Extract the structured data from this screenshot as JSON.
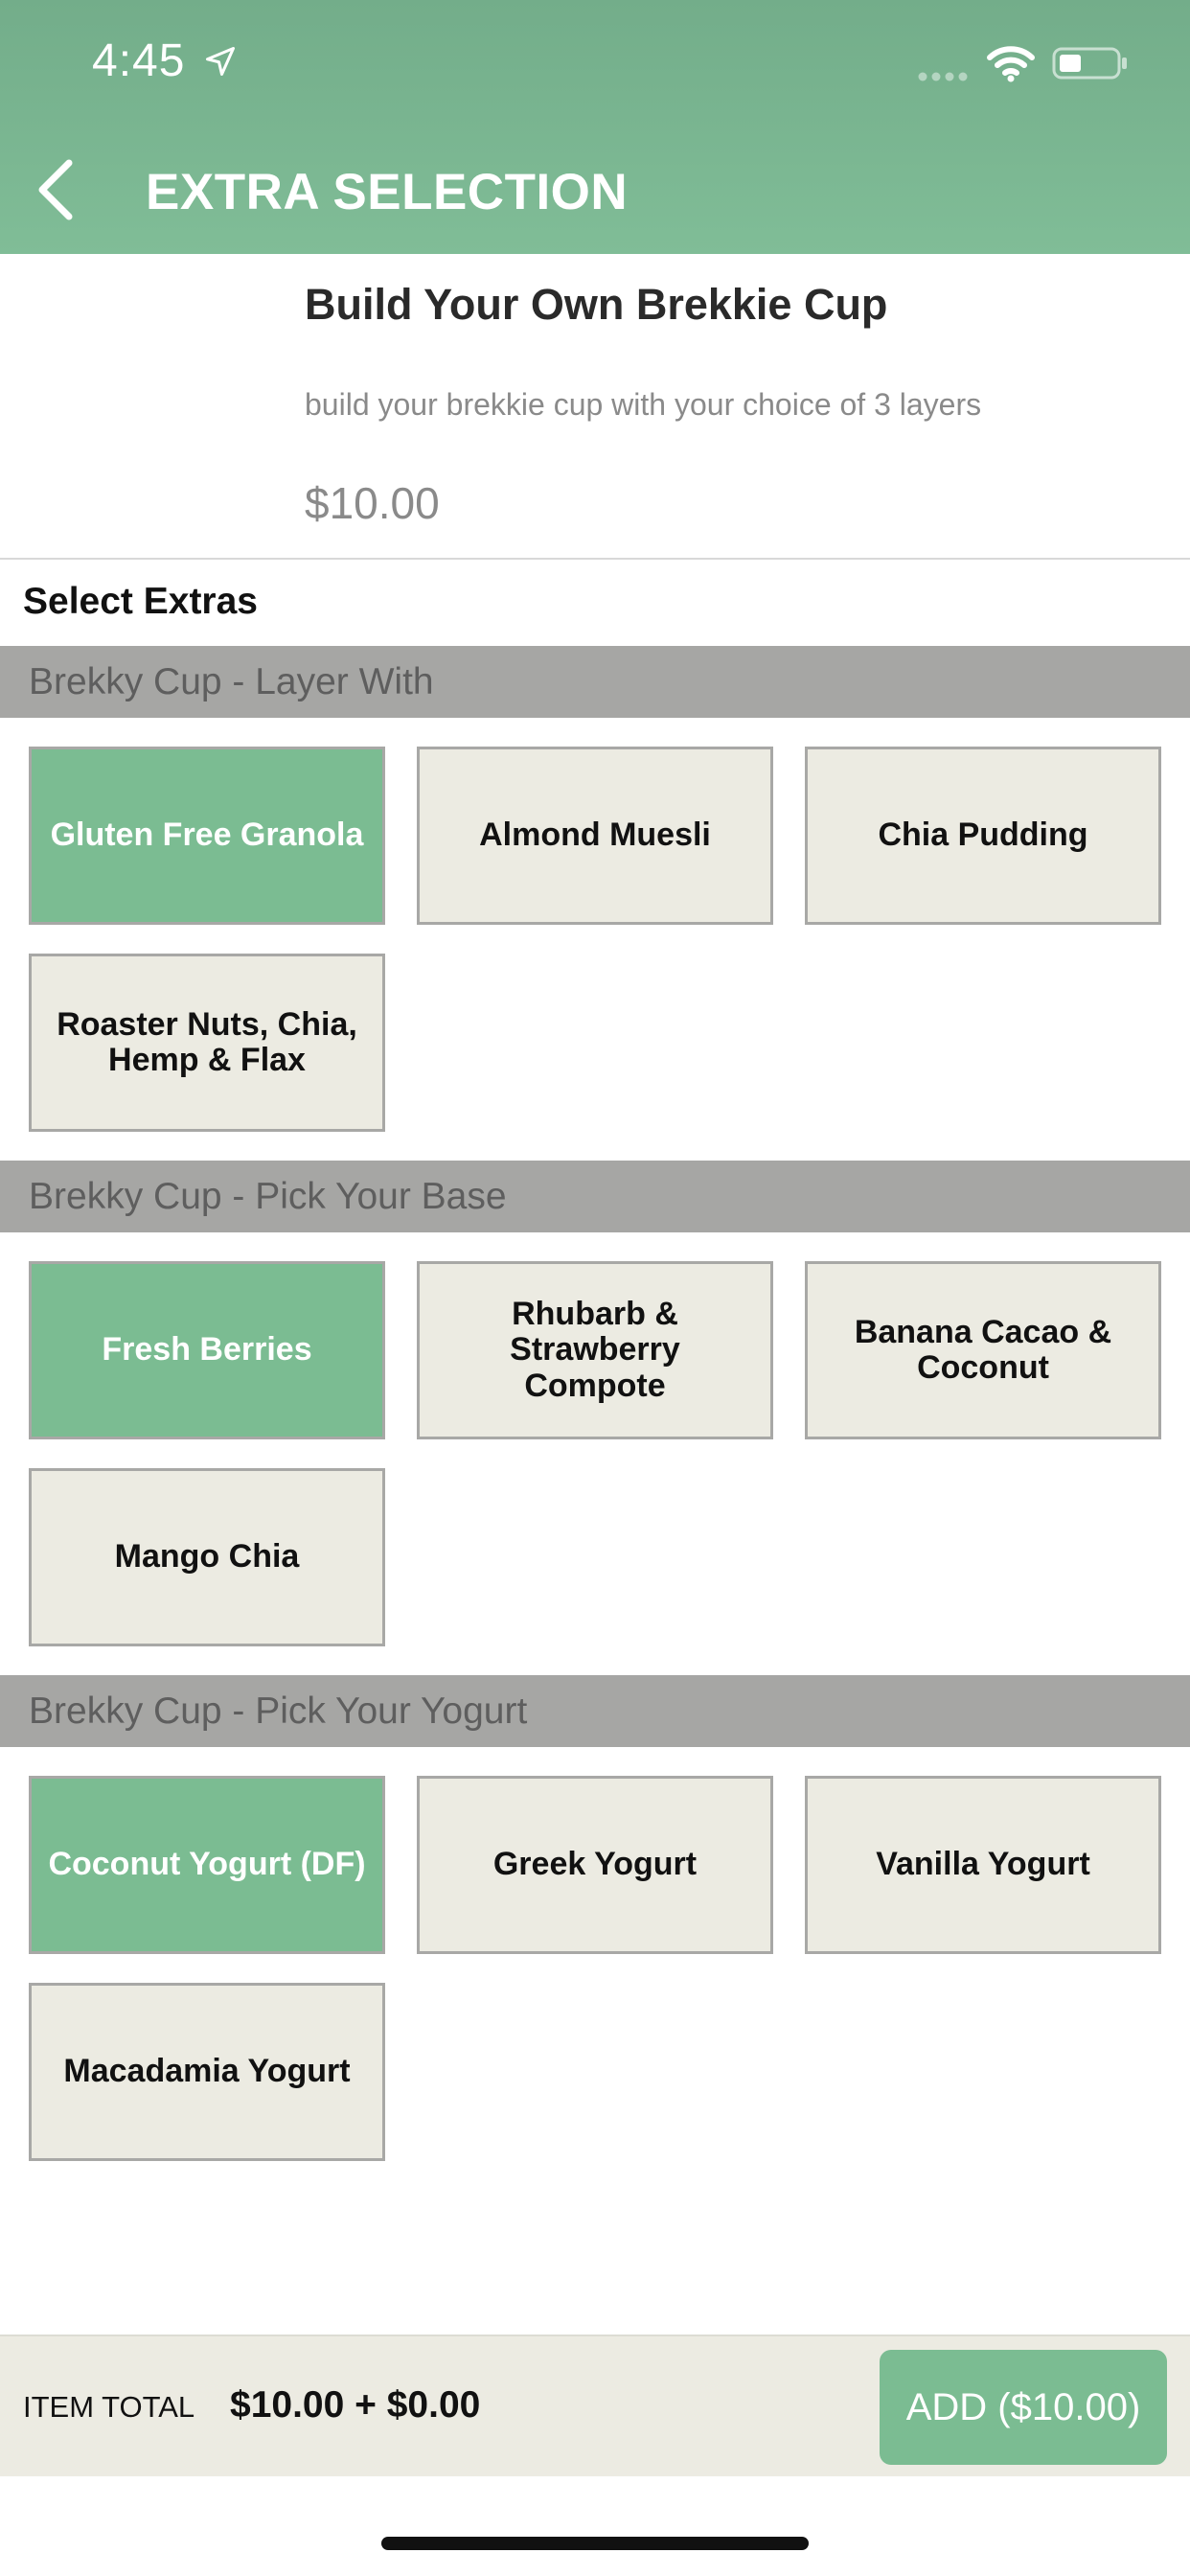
{
  "status_bar": {
    "time": "4:45"
  },
  "header": {
    "title": "EXTRA SELECTION"
  },
  "item": {
    "name": "Build Your Own Brekkie Cup",
    "description": "build your brekkie cup with your choice of 3 layers",
    "price": "$10.00"
  },
  "select_title": "Select Extras",
  "sections": [
    {
      "title": "Brekky Cup - Layer With",
      "options": [
        {
          "label": "Gluten Free Granola",
          "selected": true
        },
        {
          "label": "Almond Muesli",
          "selected": false
        },
        {
          "label": "Chia Pudding",
          "selected": false
        },
        {
          "label": "Roaster Nuts, Chia, Hemp & Flax",
          "selected": false
        }
      ]
    },
    {
      "title": "Brekky Cup - Pick Your Base",
      "options": [
        {
          "label": "Fresh Berries",
          "selected": true
        },
        {
          "label": "Rhubarb & Strawberry Compote",
          "selected": false
        },
        {
          "label": "Banana Cacao & Coconut",
          "selected": false
        },
        {
          "label": "Mango Chia",
          "selected": false
        }
      ]
    },
    {
      "title": "Brekky Cup - Pick Your Yogurt",
      "options": [
        {
          "label": "Coconut Yogurt (DF)",
          "selected": true
        },
        {
          "label": "Greek Yogurt",
          "selected": false
        },
        {
          "label": "Vanilla Yogurt",
          "selected": false
        },
        {
          "label": "Macadamia Yogurt",
          "selected": false
        }
      ]
    }
  ],
  "footer": {
    "total_label": "ITEM TOTAL",
    "total_value": "$10.00 + $0.00",
    "add_label": "ADD ($10.00)"
  },
  "colors": {
    "header_green": "#7bb591",
    "selected_tile": "#7bbc92",
    "unselected_tile": "#ecebe2",
    "section_bar": "#a6a6a4"
  }
}
